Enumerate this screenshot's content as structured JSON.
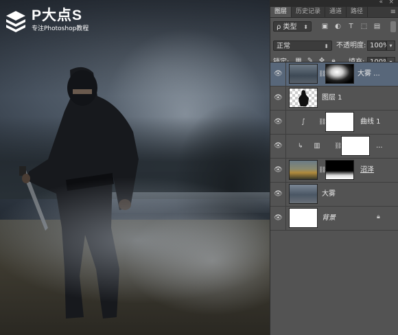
{
  "logo": {
    "title": "P大点S",
    "subtitle": "专注Photoshop教程"
  },
  "window": {
    "collapse_icon": "«",
    "close_icon": "×"
  },
  "tabs": [
    {
      "label": "图层",
      "active": true
    },
    {
      "label": "历史记录",
      "active": false
    },
    {
      "label": "通道",
      "active": false
    },
    {
      "label": "路径",
      "active": false
    }
  ],
  "panel_menu_icon": "≡",
  "filter": {
    "kind_value": "ρ 类型"
  },
  "blend": {
    "mode_value": "正常",
    "opacity_label": "不透明度:",
    "opacity_value": "100%",
    "lock_label": "锁定:",
    "fill_label": "填充:",
    "fill_value": "100%"
  },
  "layers": [
    {
      "name": "大雾 ...",
      "selected": true,
      "italic": false
    },
    {
      "name": "图层 1",
      "selected": false,
      "italic": false
    },
    {
      "name": "曲线 1",
      "selected": false,
      "italic": false
    },
    {
      "name": "...",
      "selected": false,
      "italic": false
    },
    {
      "name": "沼泽",
      "selected": false,
      "italic": false
    },
    {
      "name": "大雾",
      "selected": false,
      "italic": false
    },
    {
      "name": "背景",
      "selected": false,
      "italic": true
    }
  ],
  "colors": {
    "panel_bg": "#535353",
    "selected_row": "#58677a",
    "canvas_sky": "#4a5562"
  }
}
